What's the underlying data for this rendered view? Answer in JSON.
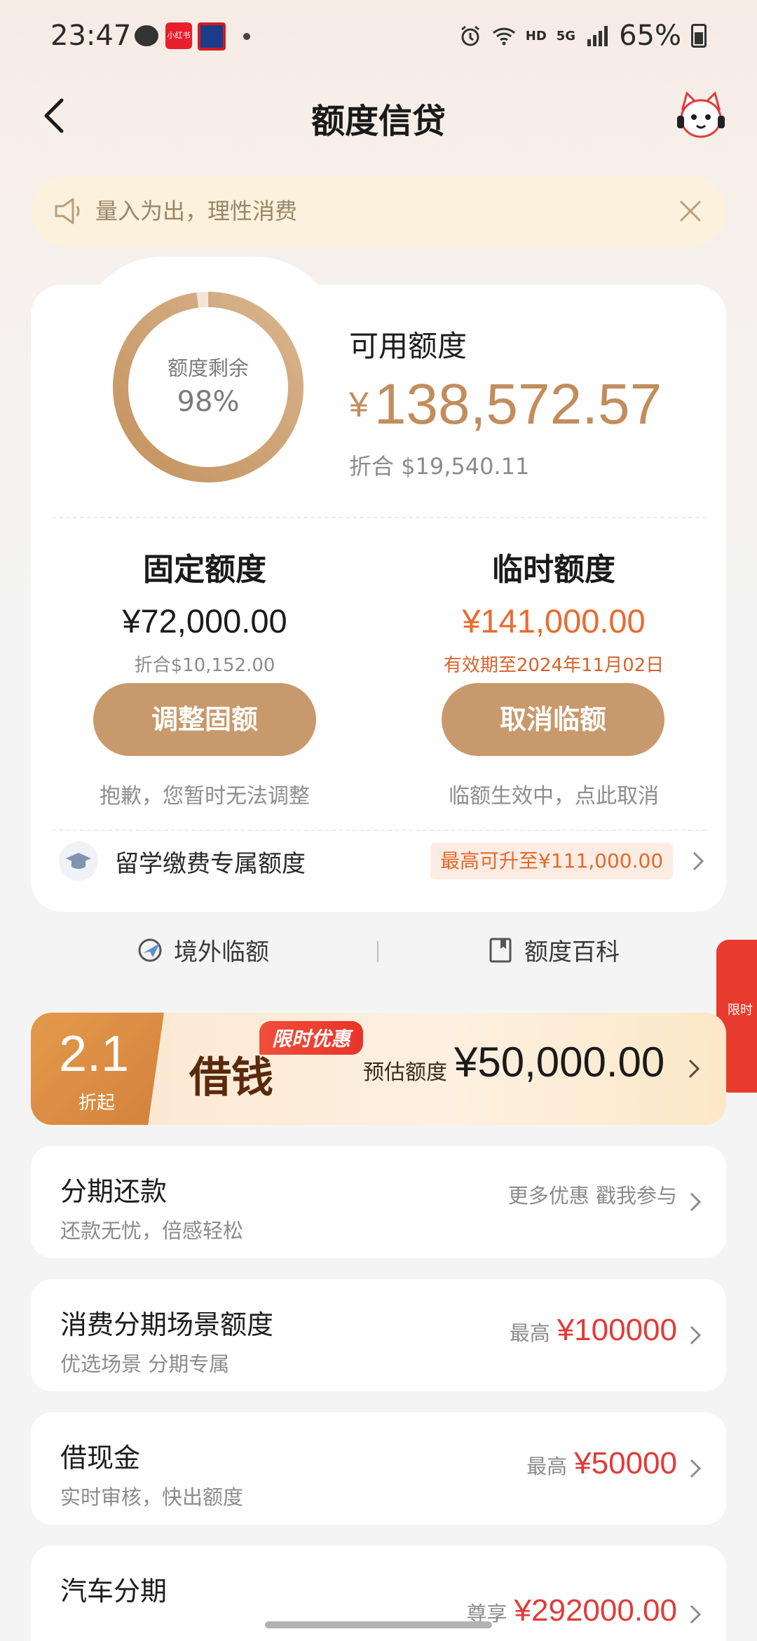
{
  "status_bar": {
    "time": "23:47",
    "app_badge": "小红书",
    "signal": "5G",
    "hd": "HD",
    "battery": "65%"
  },
  "header": {
    "title": "额度信贷"
  },
  "notice": {
    "text": "量入为出，理性消费"
  },
  "credit": {
    "ring_label": "额度剩余",
    "ring_value": "98%",
    "ring_fraction": 0.98,
    "available_label": "可用额度",
    "available_currency": "¥",
    "available_amount": "138,572.57",
    "available_usd": "折合 $19,540.11",
    "fixed": {
      "title": "固定额度",
      "amount": "¥72,000.00",
      "sub": "折合$10,152.00",
      "button": "调整固额",
      "note": "抱歉，您暂时无法调整"
    },
    "temp": {
      "title": "临时额度",
      "amount": "¥141,000.00",
      "sub": "有效期至2024年11月02日",
      "button": "取消临额",
      "note": "临额生效中，点此取消"
    },
    "study": {
      "label": "留学缴费专属额度",
      "badge": "最高可升至¥111,000.00"
    },
    "links": {
      "overseas": "境外临额",
      "encyclopedia": "额度百科"
    }
  },
  "side_float": {
    "text": "限时"
  },
  "promo": {
    "discount": "2.1",
    "discount_unit": "折起",
    "name": "借钱",
    "tag": "限时优惠",
    "est_label": "预估额度",
    "est_value": "¥50,000.00"
  },
  "services": [
    {
      "title": "分期还款",
      "sub": "还款无忧，倍感轻松",
      "pre": "",
      "value": "",
      "more": "更多优惠 戳我参与"
    },
    {
      "title": "消费分期场景额度",
      "sub": "优选场景 分期专属",
      "pre": "最高",
      "value": "¥100000",
      "more": ""
    },
    {
      "title": "借现金",
      "sub": "实时审核，快出额度",
      "pre": "最高",
      "value": "¥50000",
      "more": ""
    },
    {
      "title": "汽车分期",
      "sub": "",
      "pre": "尊享",
      "value": "¥292000.00",
      "more": ""
    }
  ],
  "colors": {
    "gold": "#c28d5d",
    "button": "#c8996c",
    "orange": "#e8692d",
    "red": "#e23a3a"
  }
}
